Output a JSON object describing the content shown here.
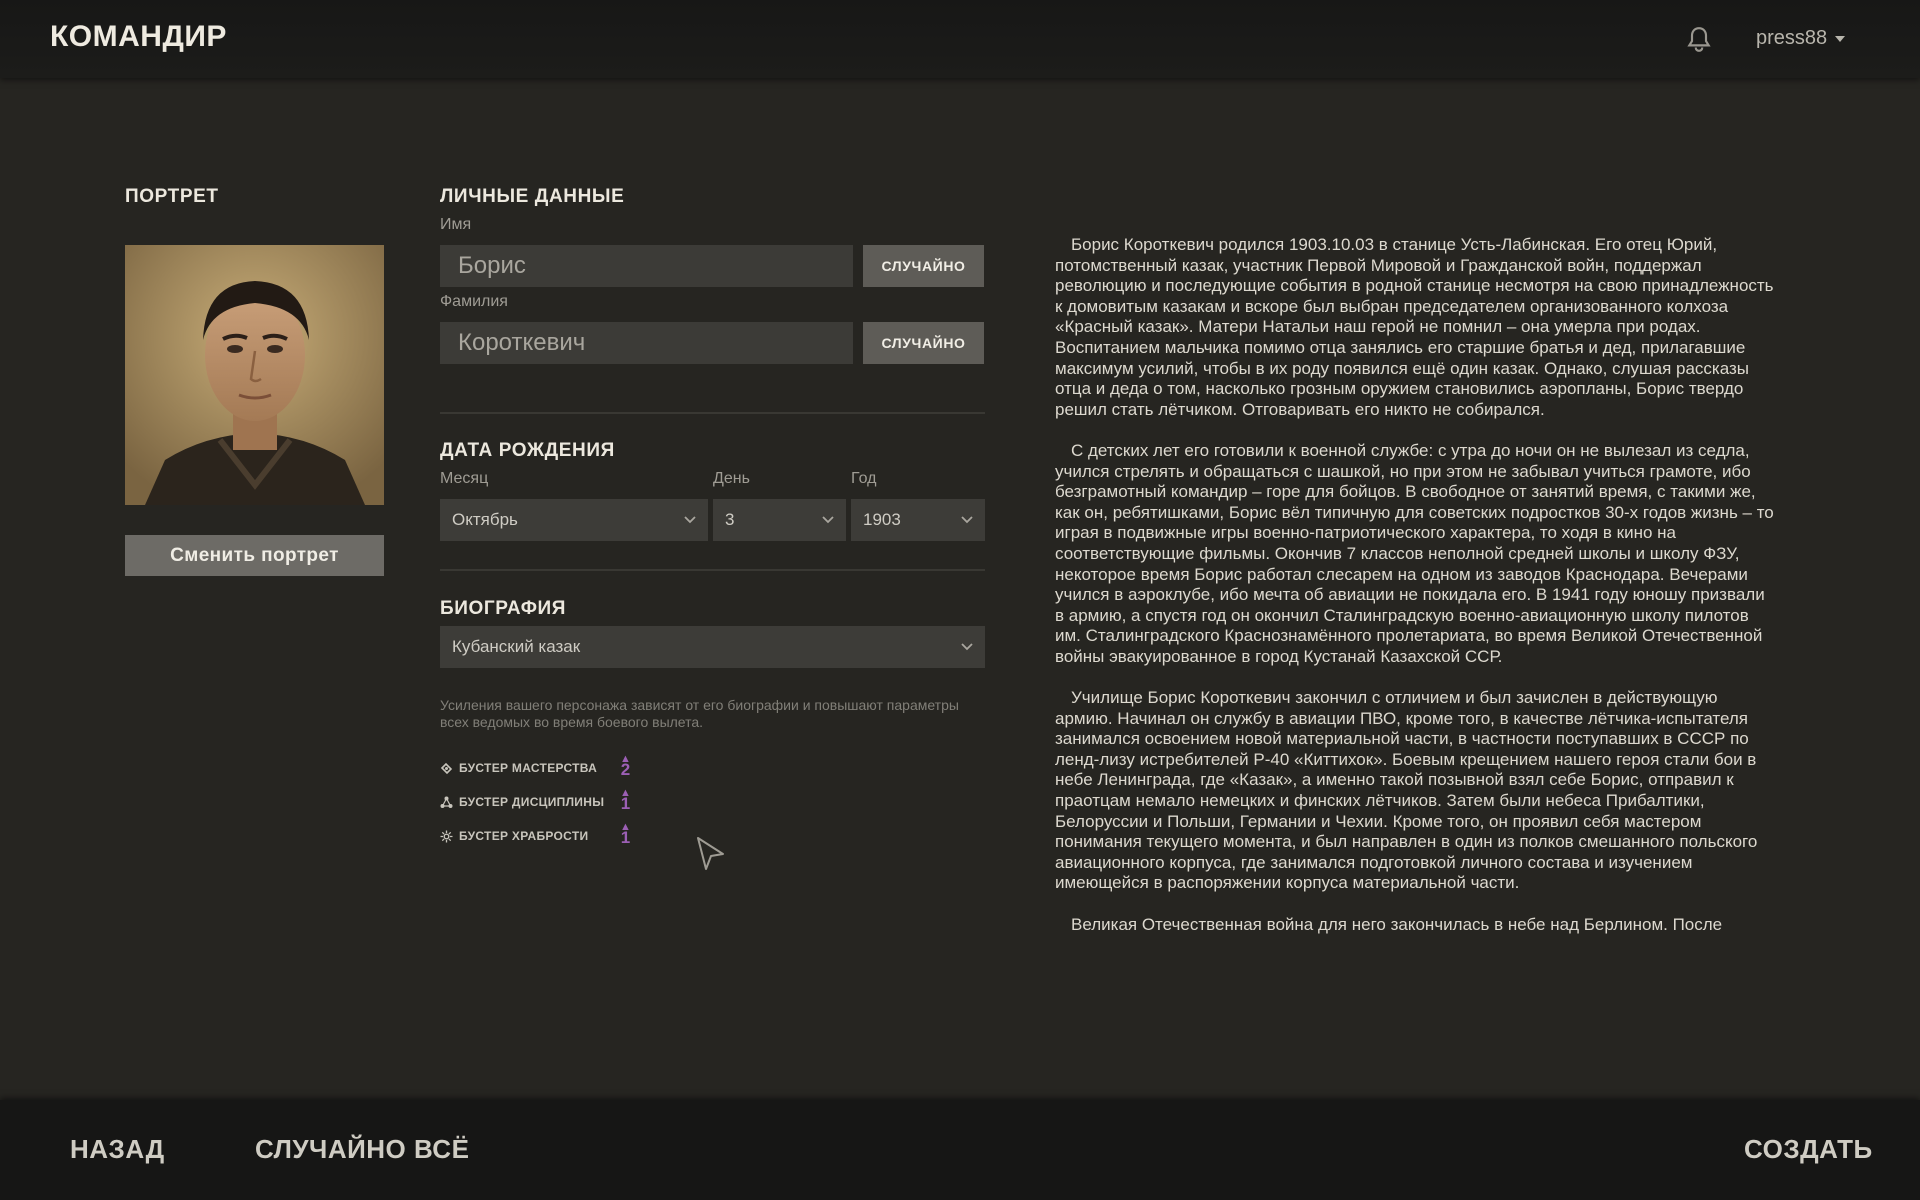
{
  "header": {
    "title": "КОМАНДИР",
    "username": "press88"
  },
  "portrait": {
    "title": "ПОРТРЕТ",
    "change_label": "Сменить портрет"
  },
  "personal": {
    "title": "ЛИЧНЫЕ ДАННЫЕ",
    "first_name_label": "Имя",
    "first_name_value": "Борис",
    "last_name_label": "Фамилия",
    "last_name_value": "Короткевич",
    "random_label": "СЛУЧАЙНО"
  },
  "birth": {
    "title": "ДАТА РОЖДЕНИЯ",
    "month_label": "Месяц",
    "month_value": "Октябрь",
    "day_label": "День",
    "day_value": "3",
    "year_label": "Год",
    "year_value": "1903"
  },
  "biography": {
    "title": "БИОГРАФИЯ",
    "selected": "Кубанский казак",
    "hint": "Усиления вашего персонажа зависят от его биографии и повышают параметры всех ведомых во время боевого вылета.",
    "boosters": [
      {
        "label": "БУСТЕР МАСТЕРСТВА",
        "value": "2"
      },
      {
        "label": "БУСТЕР ДИСЦИПЛИНЫ",
        "value": "1"
      },
      {
        "label": "БУСТЕР ХРАБРОСТИ",
        "value": "1"
      }
    ],
    "paragraphs": [
      "Борис Короткевич родился 1903.10.03 в станице Усть-Лабинская. Его отец Юрий, потомственный казак, участник Первой Мировой и Гражданской войн, поддержал революцию и последующие события в родной станице несмотря на свою принадлежность к домовитым казакам и вскоре был выбран председателем организованного колхоза «Красный казак». Матери Натальи наш герой не помнил – она умерла при родах. Воспитанием мальчика помимо отца занялись его старшие братья и дед, прилагавшие максимум усилий, чтобы в их роду появился ещё один казак. Однако, слушая рассказы отца и деда о том, насколько грозным оружием становились аэропланы, Борис твердо решил стать лётчиком. Отговаривать его никто не собирался.",
      "С детских лет его готовили к военной службе: с утра до ночи он не вылезал из седла, учился стрелять и обращаться с шашкой, но при этом не забывал учиться грамоте, ибо безграмотный командир – горе для бойцов. В свободное от занятий время, с такими же, как он, ребятишками, Борис вёл типичную для советских подростков 30-х годов жизнь – то играя в подвижные игры военно-патриотического характера, то ходя в кино на соответствующие фильмы. Окончив 7 классов неполной средней школы и школу ФЗУ, некоторое время Борис работал слесарем на одном из заводов Краснодара. Вечерами учился в аэроклубе, ибо мечта об авиации не покидала его. В 1941 году юношу призвали в армию, а спустя год он окончил Сталинградскую военно-авиационную школу пилотов им. Сталинградского Краснознамённого пролетариата, во время Великой Отечественной войны эвакуированное в город Кустанай Казахской ССР.",
      "Училище Борис Короткевич закончил с отличием и был зачислен в действующую армию. Начинал он службу в авиации ПВО, кроме того, в качестве лётчика-испытателя занимался освоением новой материальной части, в частности поступавших в СССР по ленд-лизу истребителей Р-40 «Киттихок». Боевым крещением нашего героя стали бои в небе Ленинграда, где «Казак», а именно такой позывной взял себе Борис, отправил к праотцам немало немецких и финских лётчиков. Затем были небеса Прибалтики, Белоруссии и Польши, Германии и Чехии. Кроме того, он проявил себя мастером понимания текущего момента, и был направлен в один из полков смешанного польского авиационного корпуса, где занимался подготовкой личного состава и изучением имеющейся в распоряжении корпуса материальной части.",
      "Великая Отечественная война для него закончилась в небе над Берлином. После"
    ]
  },
  "footer": {
    "back": "НАЗАД",
    "random_all": "СЛУЧАЙНО ВСЁ",
    "create": "СОЗДАТЬ"
  }
}
